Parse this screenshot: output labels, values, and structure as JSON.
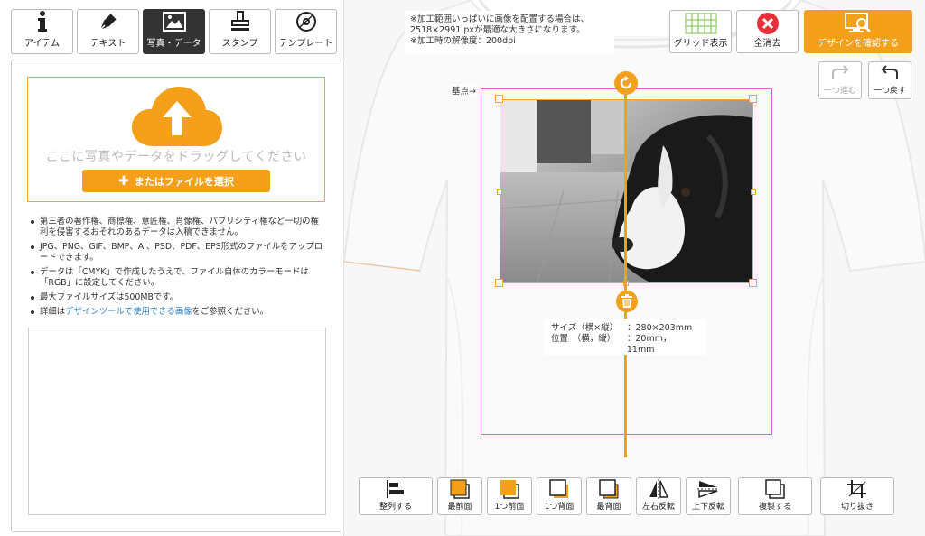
{
  "tabs": [
    {
      "label": "アイテム",
      "icon": "info-icon"
    },
    {
      "label": "テキスト",
      "icon": "pen-icon"
    },
    {
      "label": "写真・データ",
      "icon": "image-icon"
    },
    {
      "label": "スタンプ",
      "icon": "stamp-icon"
    },
    {
      "label": "テンプレート",
      "icon": "template-icon"
    }
  ],
  "upload": {
    "drop_text": "ここに写真やデータをドラッグしてください",
    "file_button": "またはファイルを選択"
  },
  "notes": [
    "第三者の著作権、商標権、意匠権、肖像権、パブリシティ権など一切の権利を侵害するおそれのあるデータは入稿できません。",
    "JPG、PNG、GIF、BMP、AI、PSD、PDF、EPS形式のファイルをアップロードできます。",
    "データは「CMYK」で作成したうえで、ファイル自体のカラーモードは「RGB」に設定してください。",
    "最大ファイルサイズは500MBです。"
  ],
  "note_link": {
    "prefix": "詳細は",
    "link": "デザインツールで使用できる画像",
    "suffix": "をご参照ください。"
  },
  "notice": {
    "line1": "※加工範囲いっぱいに画像を配置する場合は、",
    "line2": "2518×2991 pxが最適な大きさになります。",
    "line3": "※加工時の解像度：200dpi"
  },
  "top_buttons": {
    "grid": "グリッド表示",
    "clear": "全消去",
    "confirm": "デザインを確認する"
  },
  "undo": {
    "redo": "一つ進む",
    "undo": "一つ戻す"
  },
  "origin_label": "基点→",
  "info": {
    "size_label": "サイズ（横×縦）",
    "size_value": "：280×203mm",
    "pos_label": "位置　（横，縦）",
    "pos_value": "：20mm，11mm"
  },
  "bottom_buttons": {
    "align": "整列する",
    "front_most": "最前面",
    "forward": "1つ前面",
    "backward": "1つ背面",
    "back_most": "最背面",
    "flip_h": "左右反転",
    "flip_v": "上下反転",
    "duplicate": "複製する",
    "crop": "切り抜き"
  },
  "colors": {
    "accent": "#f5a01a",
    "clear_red": "#e8303a",
    "guide": "#d966d9"
  }
}
